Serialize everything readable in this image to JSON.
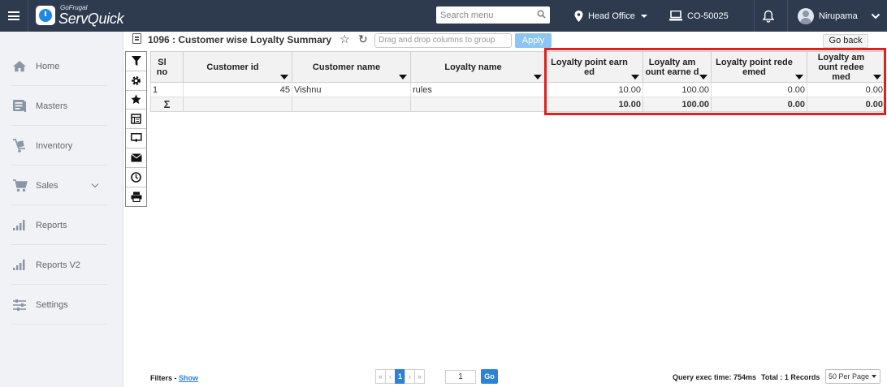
{
  "brand": {
    "small": "GoFrugal",
    "big": "ServQuick"
  },
  "topbar": {
    "search_placeholder": "Search menu",
    "location": "Head Office",
    "counter": "CO-50025",
    "user": "Nirupama"
  },
  "sidebar": {
    "items": [
      {
        "label": "Home",
        "icon": "home-icon"
      },
      {
        "label": "Masters",
        "icon": "masters-icon"
      },
      {
        "label": "Inventory",
        "icon": "inventory-icon"
      },
      {
        "label": "Sales",
        "icon": "cart-icon"
      },
      {
        "label": "Reports",
        "icon": "bar-chart-icon"
      },
      {
        "label": "Reports V2",
        "icon": "bar-chart-icon"
      },
      {
        "label": "Settings",
        "icon": "sliders-icon"
      }
    ]
  },
  "report": {
    "title": "1096 : Customer wise Loyalty Summary",
    "group_placeholder": "Drag and drop columns to group",
    "apply_label": "Apply",
    "goback_label": "Go back"
  },
  "grid": {
    "columns": [
      "Sl no",
      "Customer id",
      "Customer name",
      "Loyalty name",
      "Loyalty point earn ed",
      "Loyalty am ount earne d",
      "Loyalty point rede emed",
      "Loyalty am ount redee med"
    ],
    "rows": [
      {
        "sl": "1",
        "customer_id": "45",
        "customer_name": "Vishnu",
        "loyalty_name": "rules",
        "points_earned": "10.00",
        "amount_earned": "100.00",
        "points_redeemed": "0.00",
        "amount_redeemed": "0.00"
      }
    ],
    "totals": {
      "symbol": "Σ",
      "points_earned": "10.00",
      "amount_earned": "100.00",
      "points_redeemed": "0.00",
      "amount_redeemed": "0.00"
    }
  },
  "footer": {
    "filters_label": "Filters -",
    "filters_link": "Show",
    "pager": {
      "first": "«",
      "prev": "‹",
      "current": "1",
      "next": "›",
      "last": "»"
    },
    "page_input": "1",
    "go_label": "Go",
    "exec_time": "Query exec time: 754ms",
    "total": "Total : 1 Records",
    "per_page": "50 Per Page"
  },
  "colors": {
    "topbar": "#2e3b4e",
    "accent": "#2a83d6",
    "highlight": "#e0201f"
  }
}
